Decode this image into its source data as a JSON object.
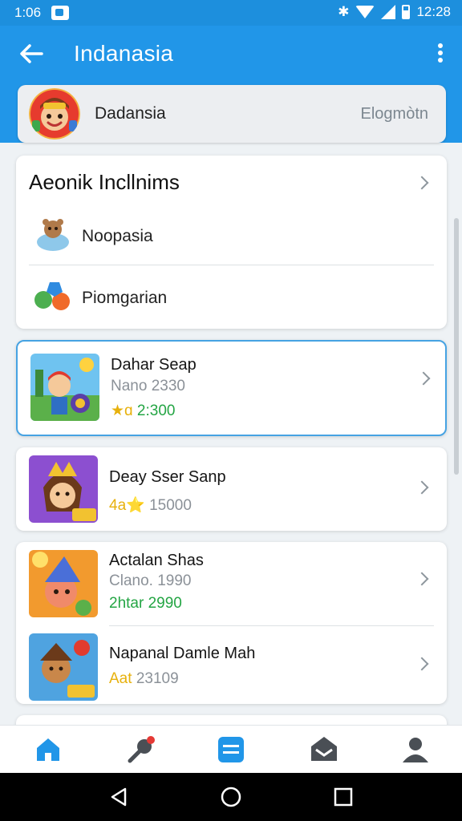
{
  "status_bar": {
    "time_left": "1:06",
    "time_right": "12:28",
    "icons": [
      "notification-icon",
      "bluetooth-icon",
      "wifi-icon",
      "signal-icon",
      "battery-icon"
    ]
  },
  "app_bar": {
    "title": "Indanasia",
    "back_icon": "arrow-left-icon",
    "menu_icon": "more-vertical-icon"
  },
  "profile": {
    "name": "Dadansia",
    "action": "Elogmòtn"
  },
  "section": {
    "title": "Aeonik Incllnims",
    "items": [
      {
        "label": "Noopasia",
        "icon": "character-icon"
      },
      {
        "label": "Piomgarian",
        "icon": "shapes-icon"
      }
    ]
  },
  "games": [
    {
      "title": "Dahar Seap",
      "subtitle": "Nano 2330",
      "rating": "2:300"
    },
    {
      "title": "Deay Sser Sanp",
      "rating_label": "4a⭐",
      "count": "15000"
    },
    {
      "title": "Actalan Shas",
      "subtitle": "Clano. 1990",
      "meta": "2htar 2990"
    },
    {
      "title": "Napanal Damle Mah",
      "rating_label": "Aat",
      "count": "23109"
    }
  ],
  "bottom_nav": [
    "home-icon",
    "tools-icon",
    "list-icon",
    "inbox-icon",
    "profile-icon"
  ],
  "colors": {
    "primary": "#2196e8",
    "status_bar": "#1d8fdd",
    "accent_green": "#24a544",
    "star": "#e7b10d"
  }
}
